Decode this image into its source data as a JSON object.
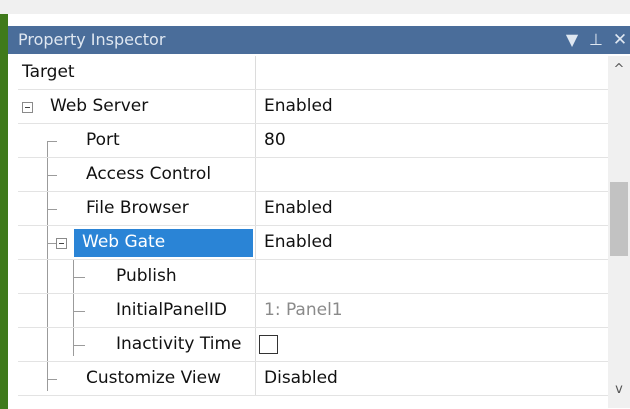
{
  "panel": {
    "title": "Property Inspector",
    "buttons": {
      "dropdown": "▼",
      "pin": "⊥",
      "close": "✕"
    }
  },
  "rows": [
    {
      "name": "Target",
      "value": ""
    },
    {
      "name": "Web Server",
      "value": "Enabled"
    },
    {
      "name": "Port",
      "value": "80"
    },
    {
      "name": "Access Control",
      "value": ""
    },
    {
      "name": "File Browser",
      "value": "Enabled"
    },
    {
      "name": "Web Gate",
      "value": "Enabled"
    },
    {
      "name": "Publish",
      "value": ""
    },
    {
      "name": "InitialPanelID",
      "value": "1: Panel1"
    },
    {
      "name": "Inactivity Time",
      "value": ""
    },
    {
      "name": "Customize View",
      "value": "Disabled"
    }
  ],
  "scrollbar": {
    "up": "^",
    "down": "v"
  },
  "colors": {
    "accent": "#3f7a1b",
    "title_bg": "#4a6d9a",
    "selection": "#2a84d6"
  }
}
